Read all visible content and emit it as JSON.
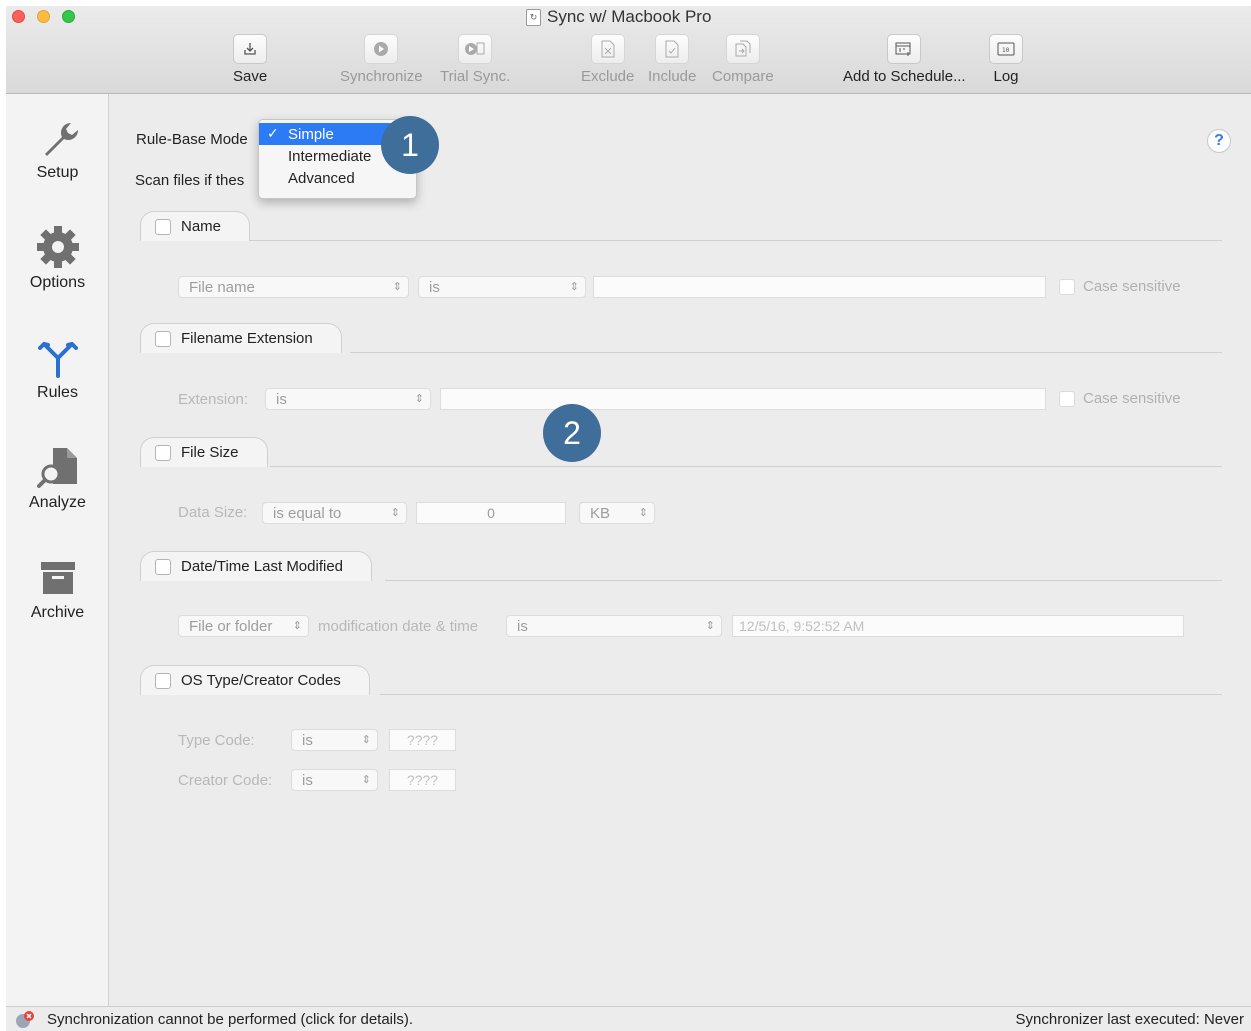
{
  "window": {
    "title": "Sync w/ Macbook Pro"
  },
  "toolbar": {
    "save": "Save",
    "synchronize": "Synchronize",
    "trial_sync": "Trial Sync.",
    "exclude": "Exclude",
    "include": "Include",
    "compare": "Compare",
    "add_to_schedule": "Add to Schedule...",
    "log": "Log"
  },
  "sidebar": {
    "items": [
      {
        "label": "Setup",
        "icon": "wrench-icon"
      },
      {
        "label": "Options",
        "icon": "gear-icon"
      },
      {
        "label": "Rules",
        "icon": "branch-icon"
      },
      {
        "label": "Analyze",
        "icon": "magnifier-document-icon"
      },
      {
        "label": "Archive",
        "icon": "archive-box-icon"
      }
    ]
  },
  "rules": {
    "mode_label": "Rule-Base Mode",
    "scan_label": "Scan files if thes",
    "mode_menu": {
      "selected": "Simple",
      "items": [
        "Simple",
        "Intermediate",
        "Advanced"
      ]
    },
    "badges": [
      "1",
      "2"
    ],
    "help": "?",
    "name": {
      "title": "Name",
      "attribute": "File name",
      "operator": "is",
      "value": "",
      "case_sensitive": "Case sensitive"
    },
    "extension": {
      "title": "Filename Extension",
      "label": "Extension:",
      "operator": "is",
      "value": "",
      "case_sensitive": "Case sensitive"
    },
    "file_size": {
      "title": "File Size",
      "label": "Data Size:",
      "operator": "is equal to",
      "value": "0",
      "unit": "KB"
    },
    "date_modified": {
      "title": "Date/Time Last Modified",
      "target": "File or folder",
      "label": "modification date & time",
      "operator": "is",
      "value": "12/5/16, 9:52:52 AM"
    },
    "os_codes": {
      "title": "OS Type/Creator Codes",
      "type_label": "Type Code:",
      "type_operator": "is",
      "type_value": "????",
      "creator_label": "Creator Code:",
      "creator_operator": "is",
      "creator_value": "????"
    }
  },
  "status": {
    "message": "Synchronization cannot be performed (click for details).",
    "last_executed": "Synchronizer last executed:  Never"
  }
}
